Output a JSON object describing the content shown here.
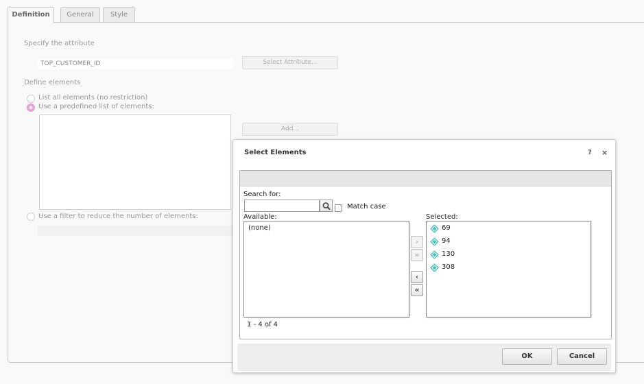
{
  "tabs": [
    {
      "label": "Definition",
      "active": true
    },
    {
      "label": "General",
      "active": false
    },
    {
      "label": "Style",
      "active": false
    }
  ],
  "definition": {
    "specify_label": "Specify the attribute",
    "attribute_value": "TOP_CUSTOMER_ID",
    "select_attribute_label": "Select Attribute...",
    "define_label": "Define elements",
    "options": [
      {
        "label": "List all elements (no restriction)",
        "selected": false
      },
      {
        "label": "Use a predefined list of elements:",
        "selected": true
      },
      {
        "label": "Use a filter to reduce the number of elements:",
        "selected": false
      }
    ],
    "add_label": "Add..."
  },
  "dialog": {
    "title": "Select Elements",
    "help": "?",
    "close": "×",
    "search_label": "Search for:",
    "search_value": "",
    "match_case_label": "Match case",
    "match_case_checked": false,
    "available_label": "Available:",
    "available_items": [
      "(none)"
    ],
    "selected_label": "Selected:",
    "selected_items": [
      "69",
      "94",
      "130",
      "308"
    ],
    "count_text": "1 - 4 of 4",
    "buttons": {
      "add_one": "›",
      "add_all": "»",
      "remove_one": "‹",
      "remove_all": "«",
      "ok": "OK",
      "cancel": "Cancel"
    }
  },
  "colors": {
    "radio_selected": "#e7a6dc",
    "element_icon": "#3fb8b0"
  }
}
